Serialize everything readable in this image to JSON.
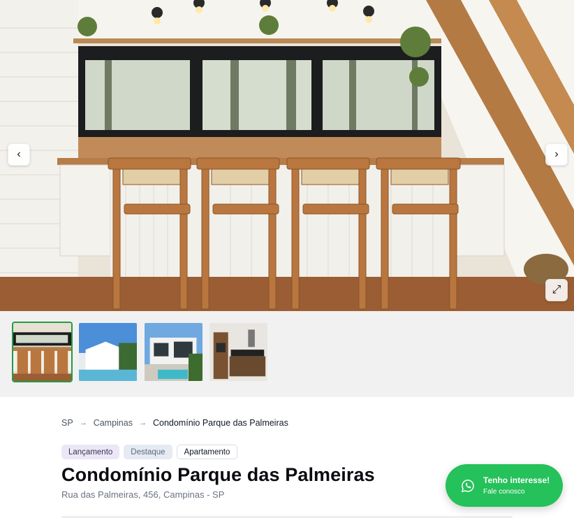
{
  "gallery": {
    "prev_label": "‹",
    "next_label": "›",
    "expand_label": "⤢",
    "thumbnails": [
      {
        "name": "kitchen-bar"
      },
      {
        "name": "pool-facade"
      },
      {
        "name": "modern-house"
      },
      {
        "name": "dark-kitchen"
      }
    ],
    "active_index": 0,
    "accent_color": "#1e9e45"
  },
  "breadcrumb": {
    "items": [
      "SP",
      "Campinas",
      "Condomínio Parque das Palmeiras"
    ],
    "separator": "→"
  },
  "badges": [
    "Lançamento",
    "Destaque",
    "Apartamento"
  ],
  "property": {
    "title": "Condomínio Parque das Palmeiras",
    "address": "Rua das Palmeiras, 456, Campinas - SP"
  },
  "cta": {
    "title": "Tenho interesse!",
    "subtitle": "Fale conosco",
    "color": "#25c15a",
    "icon": "whatsapp-icon"
  }
}
